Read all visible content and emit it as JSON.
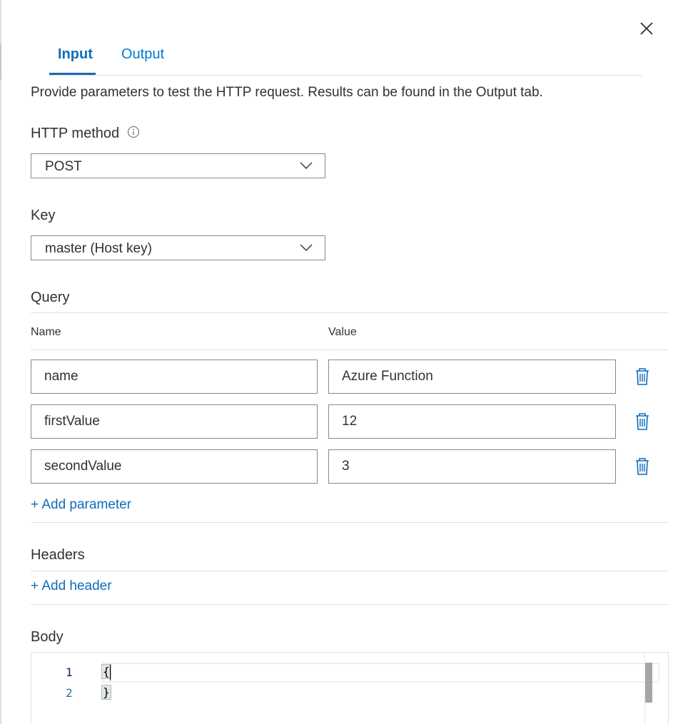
{
  "panel": {
    "tabs": [
      {
        "label": "Input",
        "active": true
      },
      {
        "label": "Output",
        "active": false
      }
    ],
    "close_icon": "close-icon",
    "description": "Provide parameters to test the HTTP request. Results can be found in the Output tab."
  },
  "http_method": {
    "label": "HTTP method",
    "info_icon": "info-icon",
    "selected": "POST"
  },
  "key": {
    "label": "Key",
    "selected": "master (Host key)"
  },
  "query": {
    "title": "Query",
    "columns": {
      "name": "Name",
      "value": "Value"
    },
    "rows": [
      {
        "name": "name",
        "value": "Azure Function"
      },
      {
        "name": "firstValue",
        "value": "12"
      },
      {
        "name": "secondValue",
        "value": "3"
      }
    ],
    "delete_icon": "trash-icon",
    "add_label": "+ Add parameter"
  },
  "headers": {
    "title": "Headers",
    "add_label": "+ Add header"
  },
  "body": {
    "title": "Body",
    "lines": [
      {
        "number": "1",
        "text": "{"
      },
      {
        "number": "2",
        "text": "}"
      }
    ]
  },
  "colors": {
    "accent": "#0f6cbd",
    "border": "#8a8886",
    "divider": "#e1dfdd",
    "text": "#323130"
  }
}
